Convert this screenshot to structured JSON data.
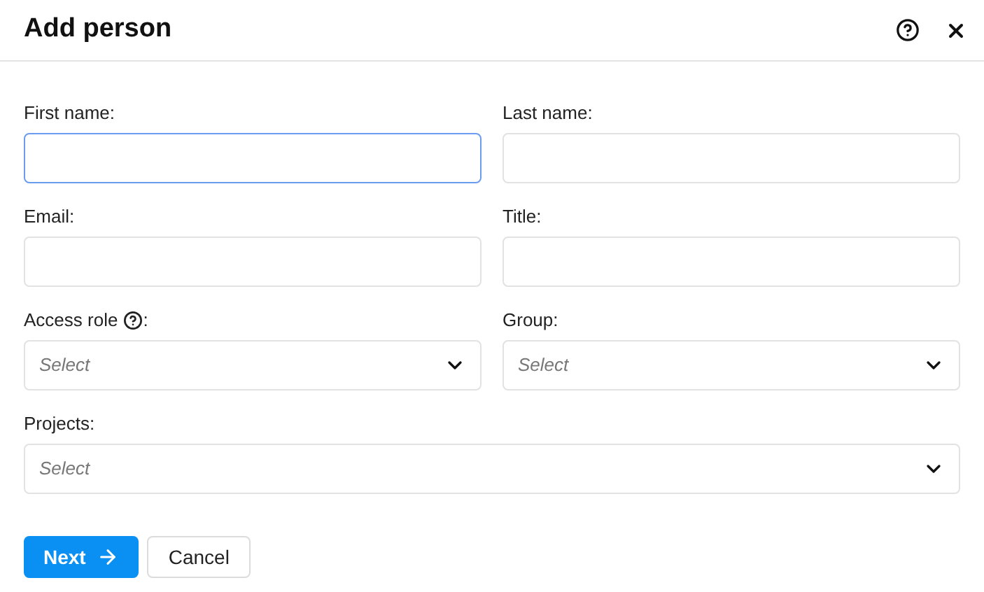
{
  "dialog": {
    "title": "Add person"
  },
  "form_rows": [
    [
      {
        "label": "First name:",
        "kind": "text",
        "focused": true
      },
      {
        "label": "Last name:",
        "kind": "text",
        "focused": false
      }
    ],
    [
      {
        "label": "Email:",
        "kind": "text",
        "focused": false
      },
      {
        "label": "Title:",
        "kind": "text",
        "focused": false
      }
    ],
    [
      {
        "label": "Access role",
        "help": true,
        "label_end": ":",
        "kind": "select",
        "placeholder": "Select",
        "focused": false
      },
      {
        "label": "Group:",
        "kind": "select",
        "placeholder": "Select",
        "focused": false
      }
    ],
    [
      {
        "label": "Projects:",
        "kind": "select",
        "placeholder": "Select",
        "focused": false
      }
    ]
  ],
  "buttons": [
    {
      "label": "Next",
      "kind": "primary"
    },
    {
      "label": "Cancel",
      "kind": "secondary"
    }
  ]
}
